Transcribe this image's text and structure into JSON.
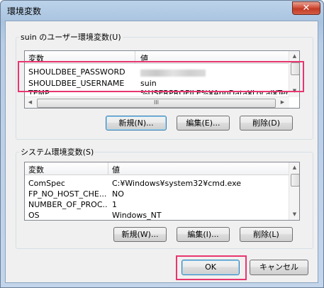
{
  "window": {
    "title": "環境変数",
    "close_glyph": "✕"
  },
  "user_section": {
    "label": "suin のユーザー環境変数(U)",
    "headers": {
      "name": "変数",
      "value": "値"
    },
    "rows": [
      {
        "name": "SHOULDBEE_PASSWORD",
        "value": ""
      },
      {
        "name": "SHOULDBEE_USERNAME",
        "value": "suin"
      },
      {
        "name": "TEMP",
        "value": "%USERPROFILE%¥AppData¥Local¥Temp"
      }
    ],
    "buttons": {
      "new": "新規(N)...",
      "edit": "編集(E)...",
      "delete": "削除(D)"
    },
    "hscroll_grip": "III"
  },
  "system_section": {
    "label": "システム環境変数(S)",
    "headers": {
      "name": "変数",
      "value": "値"
    },
    "rows": [
      {
        "name": "ComSpec",
        "value": "C:¥Windows¥system32¥cmd.exe"
      },
      {
        "name": "FP_NO_HOST_CHE...",
        "value": "NO"
      },
      {
        "name": "NUMBER_OF_PROC...",
        "value": "1"
      },
      {
        "name": "OS",
        "value": "Windows_NT"
      }
    ],
    "buttons": {
      "new": "新規(W)...",
      "edit": "編集(I)...",
      "delete": "削除(L)"
    }
  },
  "footer": {
    "ok": "OK",
    "cancel": "キャンセル"
  },
  "colors": {
    "highlight": "#e8366f"
  }
}
